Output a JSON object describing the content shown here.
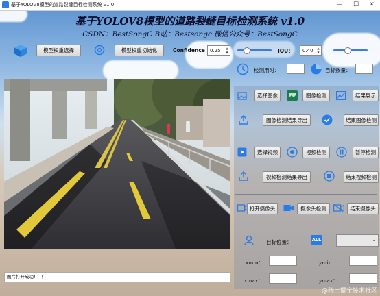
{
  "window": {
    "title": "基于YOLOV8模型的道路裂缝目标检测系统 v1.0",
    "minimize": "—",
    "maximize": "☐",
    "close": "✕"
  },
  "header": {
    "title": "基于YOLOV8模型的道路裂缝目标检测系统 v1.0",
    "subtitle": "CSDN：BestSongC   B站：Bestsongc   微信公众号：BestSongC"
  },
  "toolbar": {
    "model_select_label": "模型权重选择",
    "model_init_label": "模型权重初始化",
    "confidence_label": "Confidence",
    "confidence_value": "0.25",
    "confidence_level": 0.25,
    "iou_label": "IOU：",
    "iou_value": "0.40",
    "iou_level": 0.4
  },
  "stats": {
    "time_label": "检测用时：",
    "time_value": "",
    "count_label": "目标数量：",
    "count_value": ""
  },
  "image_section": {
    "select_image": "选择图像",
    "image_detect": "图像检测",
    "result_show": "结果展示",
    "export_image": "图像检测结果导出",
    "end_image": "结束图像检测"
  },
  "video_section": {
    "select_video": "选择视频",
    "video_detect": "视频检测",
    "pause_detect": "暂停检测",
    "export_video": "视频检测结果导出",
    "end_video": "结束视频检测"
  },
  "camera_section": {
    "open_camera": "打开摄像头",
    "camera_detect": "摄像头检测",
    "close_camera": "结束摄像头"
  },
  "target": {
    "position_label": "目标位置：",
    "all_badge": "ALL",
    "selected": "",
    "xmin_label": "xmin：",
    "ymin_label": "ymin：",
    "xmax_label": "xmax：",
    "ymax_label": "ymax：",
    "xmin": "",
    "ymin": "",
    "xmax": "",
    "ymax": ""
  },
  "status": {
    "text": "图片打开成功! ！！"
  },
  "watermark": "@稀土掘金技术社区",
  "colors": {
    "accent": "#2c7be5",
    "slider": "#3d7be0"
  }
}
